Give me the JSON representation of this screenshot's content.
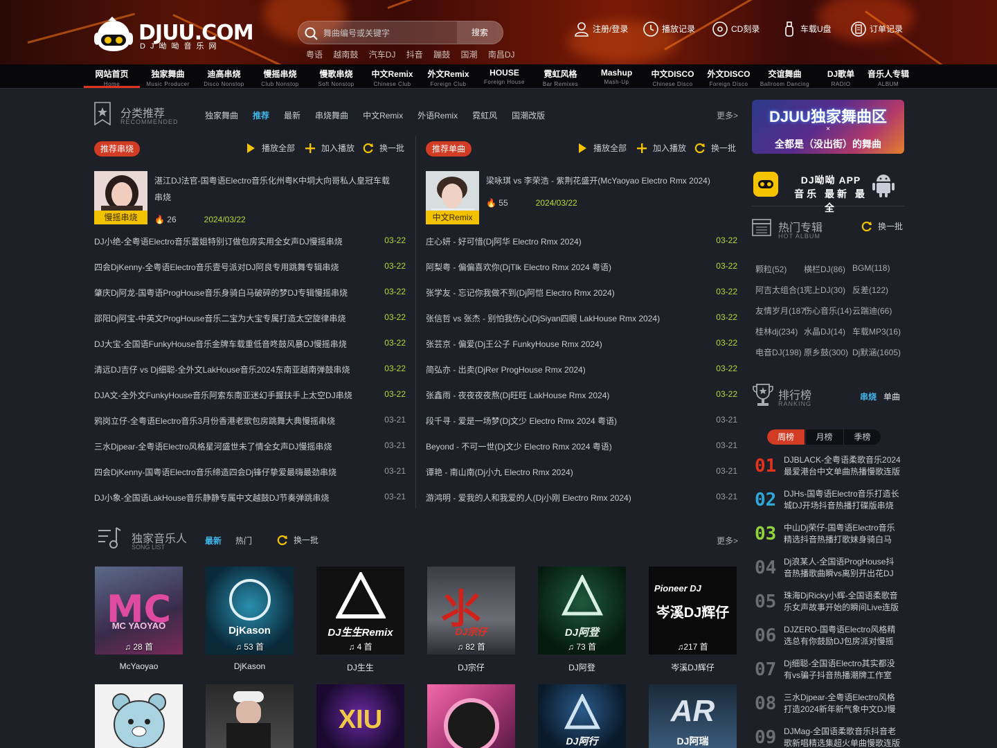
{
  "colors": {
    "accent_red": "#d23b24",
    "link_blue": "#3fb7ea",
    "date_green": "#b6d83a",
    "badge_yellow": "#f2c200",
    "fire_orange": "#f39c12"
  },
  "header": {
    "logo_title": "DJUU.COM",
    "logo_sub": "DJ呦呦音乐网",
    "search_placeholder": "舞曲编号或关键字",
    "search_button": "搜索",
    "hot_words": [
      "粤语",
      "越南鼓",
      "汽车DJ",
      "抖音",
      "蹦鼓",
      "国潮",
      "南昌DJ"
    ],
    "links": [
      {
        "label": "注册/登录",
        "icon": "user-icon"
      },
      {
        "label": "播放记录",
        "icon": "clock-icon"
      },
      {
        "label": "CD刻录",
        "icon": "cd-icon"
      },
      {
        "label": "车载U盘",
        "icon": "usb-icon"
      },
      {
        "label": "订单记录",
        "icon": "order-icon"
      }
    ]
  },
  "nav": [
    {
      "zh": "网站首页",
      "en": "Home"
    },
    {
      "zh": "独家舞曲",
      "en": "Music Producer"
    },
    {
      "zh": "迪高串烧",
      "en": "Disco Nonstop"
    },
    {
      "zh": "慢摇串烧",
      "en": "Club Nonstop"
    },
    {
      "zh": "慢歌串烧",
      "en": "Soft Nonstop"
    },
    {
      "zh": "中文Remix",
      "en": "Chinese Club"
    },
    {
      "zh": "外文Remix",
      "en": "Foreign Club"
    },
    {
      "zh": "HOUSE",
      "en": "Foreign House"
    },
    {
      "zh": "霓虹风格",
      "en": "Bar Remixes"
    },
    {
      "zh": "Mashup",
      "en": "Mash-Up"
    },
    {
      "zh": "中文DISCO",
      "en": "Chinese Disco"
    },
    {
      "zh": "外文DISCO",
      "en": "Foreign Disco"
    },
    {
      "zh": "交谊舞曲",
      "en": "Ballroom Dancing"
    },
    {
      "zh": "DJ歌单",
      "en": "RADIO"
    },
    {
      "zh": "音乐人专辑",
      "en": "ALBUM"
    }
  ],
  "recommend": {
    "title": "分类推荐",
    "subtitle": "RECOMMENDED",
    "tabs": [
      "独家舞曲",
      "推荐",
      "最新",
      "串烧舞曲",
      "中文Remix",
      "外语Remix",
      "霓虹风",
      "国潮改版"
    ],
    "active_tab": "推荐",
    "more": "更多>",
    "play_all": "播放全部",
    "add_to_play": "加入播放",
    "refresh": "换一批",
    "left": {
      "pill": "推荐串烧",
      "feature": {
        "badge": "慢摇串烧",
        "title": "湛江DJ法官-国粤语Electro音乐化州粤K中垌大向哥私人皇冠车载串烧",
        "heat": "26",
        "date": "2024/03/22"
      },
      "rows": [
        {
          "title": "DJ小绝-全粤语Electro音乐蕾姐特别订做包房实用全女声DJ慢摇串烧",
          "date": "03-22"
        },
        {
          "title": "四会DjKenny-全粤语Electro音乐壹号派对DJ阿良专用跳舞专辑串烧",
          "date": "03-22"
        },
        {
          "title": "肇庆Dj阿龙-国粤语ProgHouse音乐身骑白马破碎的梦DJ专辑慢摇串烧",
          "date": "03-22"
        },
        {
          "title": "邵阳Dj阿宝-中英文ProgHouse音乐二宝为大宝专属打造太空旋律串烧",
          "date": "03-22"
        },
        {
          "title": "DJ大宝-全国语FunkyHouse音乐金牌车载重低音咚鼓风暴DJ慢摇串烧",
          "date": "03-22"
        },
        {
          "title": "清远DJ吉仔 vs Dj细聪-全外文LakHouse音乐2024东南亚越南弹鼓串烧",
          "date": "03-22"
        },
        {
          "title": "DJA文-全外文FunkyHouse音乐阿索东南亚迷幻手握扶手上太空DJ串烧",
          "date": "03-22"
        },
        {
          "title": "鸦岗立仔-全粤语Electro音乐3月份香港老歌包房跳舞大典慢摇串烧",
          "date": "03-21"
        },
        {
          "title": "三水Djpear-全粤语Electro风格星河盛世未了情全女声DJ慢摇串烧",
          "date": "03-21"
        },
        {
          "title": "四会DjKenny-国粤语Electro音乐缔造四会Dj锋仔挚爱最嗨最劲串烧",
          "date": "03-21"
        },
        {
          "title": "DJ小象-全国语LakHouse音乐静静专属中文越鼓DJ节奏弹跳串烧",
          "date": "03-21"
        }
      ]
    },
    "right": {
      "pill": "推荐单曲",
      "feature": {
        "badge": "中文Remix",
        "title": "梁咏琪 vs 李荣浩 - 紫荆花盛开(McYaoyao Electro Rmx 2024)",
        "heat": "55",
        "date": "2024/03/22"
      },
      "rows": [
        {
          "title": "庄心妍 - 好可惜(Dj阿华 Electro Rmx 2024)",
          "date": "03-22"
        },
        {
          "title": "阿梨粤 - 偏偏喜欢你(DjTlk Electro Rmx 2024 粤语)",
          "date": "03-22"
        },
        {
          "title": "张学友 - 忘记你我做不到(Dj阿恺 Electro Rmx 2024)",
          "date": "03-22"
        },
        {
          "title": "张信哲 vs 张杰 - 别怕我伤心(DjSiyan四眼 LakHouse Rmx 2024)",
          "date": "03-22"
        },
        {
          "title": "张芸京 - 偏爱(Dj王公子 FunkyHouse Rmx 2024)",
          "date": "03-22"
        },
        {
          "title": "简弘亦 - 出卖(DjRer ProgHouse Rmx 2024)",
          "date": "03-22"
        },
        {
          "title": "张鑫雨 - 夜夜夜夜熬(Dj旺旺 LakHouse Rmx 2024)",
          "date": "03-22"
        },
        {
          "title": "段千寻 - 爱是一场梦(Dj文少 Electro Rmx 2024 粤语)",
          "date": "03-21"
        },
        {
          "title": "Beyond - 不可一世(Dj文少 Electro Rmx 2024 粤语)",
          "date": "03-21"
        },
        {
          "title": "谭艳 - 南山南(Dj小九 Electro Rmx 2024)",
          "date": "03-21"
        },
        {
          "title": "游鸿明 - 爱我的人和我爱的人(Dj小刚 Electro Rmx 2024)",
          "date": "03-21"
        }
      ]
    }
  },
  "artists": {
    "title": "独家音乐人",
    "subtitle": "SONG LIST",
    "tabs": [
      "最新",
      "热门"
    ],
    "active_tab": "最新",
    "refresh": "换一批",
    "more": "更多>",
    "cards": [
      {
        "name": "McYaoyao",
        "count": "28 首",
        "cover_text": "MC YAOYAO"
      },
      {
        "name": "DjKason",
        "count": "53 首",
        "cover_text": "DjKason"
      },
      {
        "name": "DJ生生",
        "count": "4 首",
        "cover_text": "DJ生生Remix"
      },
      {
        "name": "DJ宗仔",
        "count": "82 首",
        "cover_text": "DJ宗仔"
      },
      {
        "name": "DJ阿登",
        "count": "73 首",
        "cover_text": "DJ阿登"
      },
      {
        "name": "岑溪DJ辉仔",
        "count": "217 首",
        "cover_text": "岑溪DJ辉仔"
      }
    ],
    "row2_cover_text": [
      "",
      "",
      "XIU",
      "",
      "DJ阿行",
      "DJ阿瑞"
    ]
  },
  "sidebar": {
    "banner_title": "DJUU独家舞曲区",
    "banner_x": "×",
    "banner_sub": "全都是（没出街）的舞曲",
    "app_line1": "DJ呦呦 APP",
    "app_line2": "音乐 最新 最全",
    "hot_album": {
      "title": "热门专辑",
      "subtitle": "HOT ALBUM",
      "refresh": "换一批",
      "tags": [
        "颗粒(52)",
        "横栏DJ(86)",
        "BGM(118)",
        "阿吉太组合(1",
        "宪上DJ(30)",
        "反差(122)",
        "友情岁月(187",
        "伤心音乐(14)",
        "云踹迪(66)",
        "桂林dj(234)",
        "水晶DJ(14)",
        "车载MP3(16)",
        "电音DJ(198)",
        "原乡鼓(300)",
        "Dj默涵(1605)"
      ]
    },
    "ranking": {
      "title": "排行榜",
      "subtitle": "RANKING",
      "toggle": [
        "串烧",
        "单曲"
      ],
      "active_toggle": "串烧",
      "periods": [
        "周榜",
        "月榜",
        "季榜"
      ],
      "active_period": "周榜",
      "items": [
        {
          "num": "01",
          "title": "DJBLACK-全粤语柔歌音乐2024最爱港台中文单曲热播慢歌连版"
        },
        {
          "num": "02",
          "title": "DJHs-国粤语Electro音乐打造长城DJ开场抖音热播打碟版串烧"
        },
        {
          "num": "03",
          "title": "中山Dj荣仔-国粤语Electro音乐精选抖音热播打歌妹身骑白马"
        },
        {
          "num": "04",
          "title": "Dj浪某人-全国语ProgHouse抖音热播歌曲瞬vs离别开出花DJ"
        },
        {
          "num": "05",
          "title": "珠海DjRicky小辉-全国语柔歌音乐女声故事开始的瞬间Live连版"
        },
        {
          "num": "06",
          "title": "DJZERO-国粤语Electro风格精选总有你鼓励DJ包房派对慢摇"
        },
        {
          "num": "07",
          "title": "Dj细聪-全国语Electro其实都没有vs骗子抖音热播潮牌工作室"
        },
        {
          "num": "08",
          "title": "三水Djpear-全粤语Electro风格打造2024新年新气象中文DJ慢"
        },
        {
          "num": "09",
          "title": "DJMag-全国语柔歌音乐抖音老歌新唱精选集超火单曲慢歌连版"
        }
      ],
      "rank_colors": [
        "#e0331e",
        "#2fa8d8",
        "#8fd43a",
        "#6b6e76",
        "#6b6e76",
        "#6b6e76",
        "#6b6e76",
        "#6b6e76",
        "#6b6e76"
      ]
    }
  }
}
